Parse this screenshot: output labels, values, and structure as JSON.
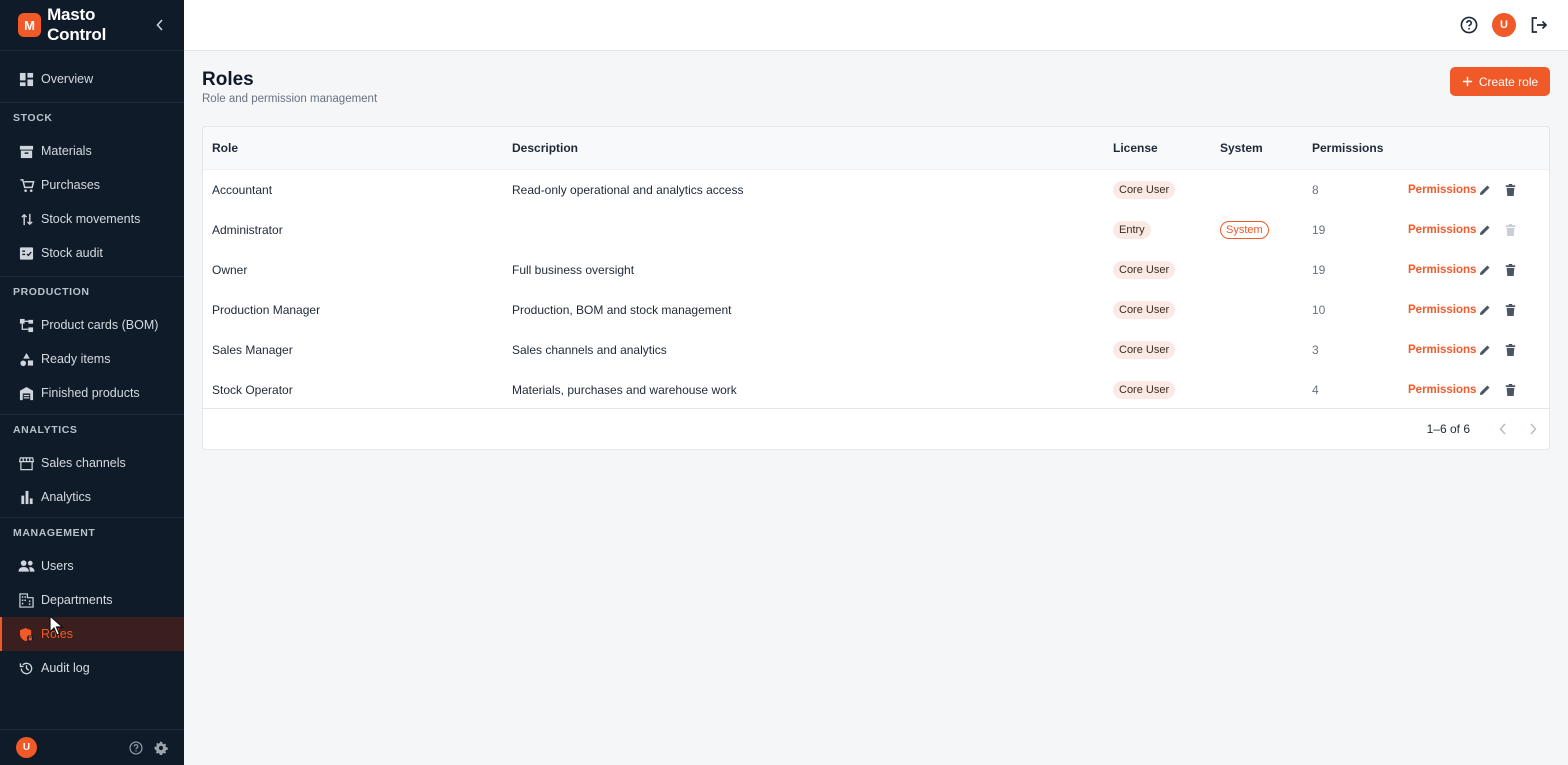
{
  "app": {
    "logo_letter": "M",
    "name": "Masto Control"
  },
  "sidebar": {
    "top_item": {
      "label": "Overview",
      "icon": "dashboard-icon"
    },
    "sections": [
      {
        "title": "STOCK",
        "items": [
          {
            "label": "Materials",
            "icon": "archive-icon"
          },
          {
            "label": "Purchases",
            "icon": "cart-icon"
          },
          {
            "label": "Stock movements",
            "icon": "swap-vertical-icon"
          },
          {
            "label": "Stock audit",
            "icon": "checklist-icon"
          }
        ]
      },
      {
        "title": "PRODUCTION",
        "items": [
          {
            "label": "Product cards (BOM)",
            "icon": "tree-icon"
          },
          {
            "label": "Ready items",
            "icon": "shapes-icon"
          },
          {
            "label": "Finished products",
            "icon": "warehouse-icon"
          }
        ]
      },
      {
        "title": "ANALYTICS",
        "items": [
          {
            "label": "Sales channels",
            "icon": "store-icon"
          },
          {
            "label": "Analytics",
            "icon": "bar-chart-icon"
          }
        ]
      },
      {
        "title": "MANAGEMENT",
        "items": [
          {
            "label": "Users",
            "icon": "users-icon"
          },
          {
            "label": "Departments",
            "icon": "building-icon"
          },
          {
            "label": "Roles",
            "icon": "shield-lock-icon",
            "active": true
          },
          {
            "label": "Audit log",
            "icon": "history-icon"
          }
        ]
      }
    ],
    "footer": {
      "avatar_letter": "U"
    }
  },
  "topbar": {
    "avatar_letter": "U"
  },
  "page": {
    "title": "Roles",
    "subtitle": "Role and permission management",
    "create_button": "Create role"
  },
  "table": {
    "headers": {
      "role": "Role",
      "description": "Description",
      "license": "License",
      "system": "System",
      "permissions": "Permissions"
    },
    "rows": [
      {
        "role": "Accountant",
        "description": "Read-only operational and analytics access",
        "license": "Core User",
        "system": "",
        "permissions": "8",
        "link": "Permissions",
        "delete_enabled": true
      },
      {
        "role": "Administrator",
        "description": "",
        "license": "Entry",
        "system": "System",
        "permissions": "19",
        "link": "Permissions",
        "delete_enabled": false
      },
      {
        "role": "Owner",
        "description": "Full business oversight",
        "license": "Core User",
        "system": "",
        "permissions": "19",
        "link": "Permissions",
        "delete_enabled": true
      },
      {
        "role": "Production Manager",
        "description": "Production, BOM and stock management",
        "license": "Core User",
        "system": "",
        "permissions": "10",
        "link": "Permissions",
        "delete_enabled": true
      },
      {
        "role": "Sales Manager",
        "description": "Sales channels and analytics",
        "license": "Core User",
        "system": "",
        "permissions": "3",
        "link": "Permissions",
        "delete_enabled": true
      },
      {
        "role": "Stock Operator",
        "description": "Materials, purchases and warehouse work",
        "license": "Core User",
        "system": "",
        "permissions": "4",
        "link": "Permissions",
        "delete_enabled": true
      }
    ],
    "pagination": {
      "range": "1–6 of 6"
    }
  },
  "colors": {
    "accent": "#f05a28",
    "sidebar_bg": "#101b29",
    "page_bg": "#f5f6f8"
  }
}
